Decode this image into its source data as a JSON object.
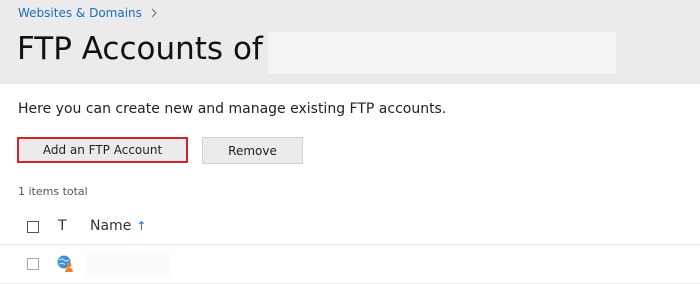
{
  "breadcrumb": {
    "link_label": "Websites & Domains",
    "separator_icon": "chevron-right-icon"
  },
  "header": {
    "title": "FTP Accounts of"
  },
  "intro": {
    "text": "Here you can create new and manage existing FTP accounts."
  },
  "toolbar": {
    "add_label": "Add an FTP Account",
    "remove_label": "Remove",
    "add_highlight_color": "#d7222c"
  },
  "list": {
    "items_total": "1 items total",
    "columns": {
      "type": "T",
      "name": "Name"
    },
    "sort_icon": "arrow-up-icon",
    "rows": [
      {
        "type_icon": "ftp-account-icon"
      }
    ]
  },
  "colors": {
    "link": "#1a6fbf",
    "header_bg": "#ebebeb"
  }
}
